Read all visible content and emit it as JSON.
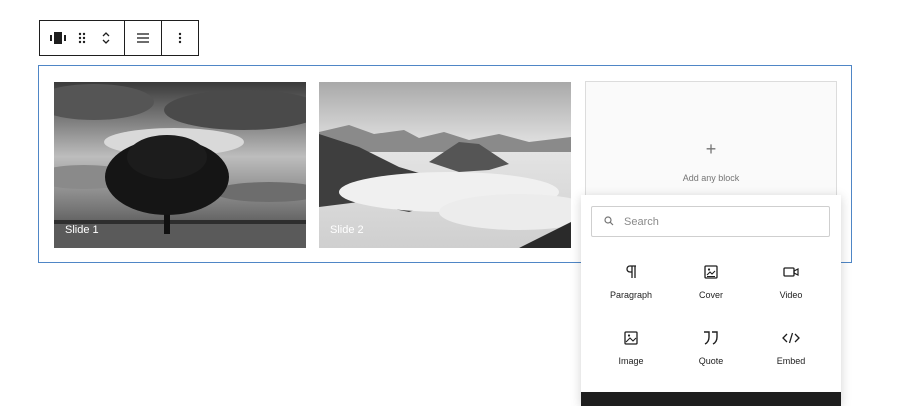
{
  "toolbar": {
    "icons": [
      "carousel-block-icon",
      "drag-handle-icon",
      "move-up-down-icon",
      "align-icon",
      "more-options-icon"
    ]
  },
  "slides": [
    {
      "label": "Slide 1"
    },
    {
      "label": "Slide 2"
    }
  ],
  "empty_slide": {
    "plus": "+",
    "text": "Add any block"
  },
  "inserter": {
    "search_placeholder": "Search",
    "blocks": [
      {
        "label": "Paragraph",
        "icon": "paragraph-icon"
      },
      {
        "label": "Cover",
        "icon": "cover-icon"
      },
      {
        "label": "Video",
        "icon": "video-icon"
      },
      {
        "label": "Image",
        "icon": "image-icon"
      },
      {
        "label": "Quote",
        "icon": "quote-icon"
      },
      {
        "label": "Embed",
        "icon": "embed-icon"
      }
    ]
  },
  "colors": {
    "selection_border": "#4f86c6",
    "text": "#1e1e1e",
    "muted": "#757575"
  }
}
